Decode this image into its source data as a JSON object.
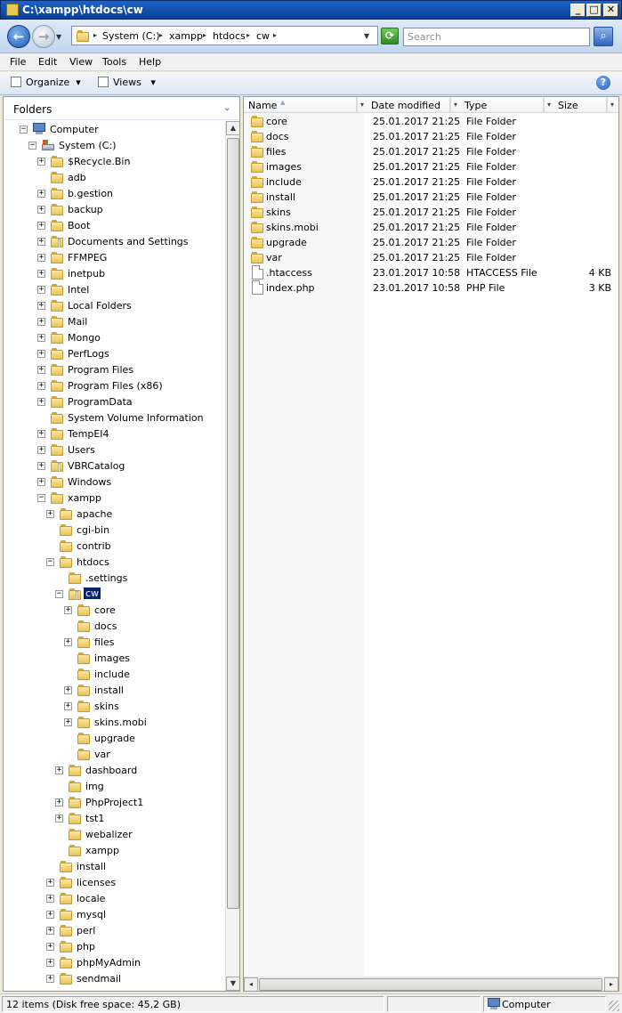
{
  "window": {
    "title": "C:\\xampp\\htdocs\\cw",
    "buttons": {
      "minimize": "_",
      "maximize": "□",
      "close": "✕"
    }
  },
  "address": {
    "crumbs": [
      "System (C:)",
      "xampp",
      "htdocs",
      "cw"
    ],
    "search_placeholder": "Search"
  },
  "menu": [
    "File",
    "Edit",
    "View",
    "Tools",
    "Help"
  ],
  "toolbar": {
    "organize": "Organize",
    "views": "Views",
    "help": "?"
  },
  "folders_pane": {
    "title": "Folders"
  },
  "tree": [
    {
      "label": "Computer",
      "level": 0,
      "icon": "computer-icon",
      "expander": "minus"
    },
    {
      "label": "System (C:)",
      "level": 1,
      "icon": "drive-icon",
      "expander": "minus"
    },
    {
      "label": "$Recycle.Bin",
      "level": 2,
      "icon": "folder-icon",
      "expander": "plus"
    },
    {
      "label": "adb",
      "level": 2,
      "icon": "folder-icon",
      "expander": "none"
    },
    {
      "label": "b.gestion",
      "level": 2,
      "icon": "folder-icon",
      "expander": "plus"
    },
    {
      "label": "backup",
      "level": 2,
      "icon": "folder-icon",
      "expander": "plus"
    },
    {
      "label": "Boot",
      "level": 2,
      "icon": "folder-icon",
      "expander": "plus"
    },
    {
      "label": "Documents and Settings",
      "level": 2,
      "icon": "folder-shortcut-icon",
      "expander": "plus"
    },
    {
      "label": "FFMPEG",
      "level": 2,
      "icon": "folder-icon",
      "expander": "plus"
    },
    {
      "label": "inetpub",
      "level": 2,
      "icon": "folder-icon",
      "expander": "plus"
    },
    {
      "label": "Intel",
      "level": 2,
      "icon": "folder-icon",
      "expander": "plus"
    },
    {
      "label": "Local Folders",
      "level": 2,
      "icon": "folder-icon",
      "expander": "plus"
    },
    {
      "label": "Mail",
      "level": 2,
      "icon": "folder-icon",
      "expander": "plus"
    },
    {
      "label": "Mongo",
      "level": 2,
      "icon": "folder-icon",
      "expander": "plus"
    },
    {
      "label": "PerfLogs",
      "level": 2,
      "icon": "folder-icon",
      "expander": "plus"
    },
    {
      "label": "Program Files",
      "level": 2,
      "icon": "folder-icon",
      "expander": "plus"
    },
    {
      "label": "Program Files (x86)",
      "level": 2,
      "icon": "folder-icon",
      "expander": "plus"
    },
    {
      "label": "ProgramData",
      "level": 2,
      "icon": "folder-icon",
      "expander": "plus"
    },
    {
      "label": "System Volume Information",
      "level": 2,
      "icon": "folder-icon",
      "expander": "none"
    },
    {
      "label": "TempEI4",
      "level": 2,
      "icon": "folder-icon",
      "expander": "plus"
    },
    {
      "label": "Users",
      "level": 2,
      "icon": "folder-icon",
      "expander": "plus"
    },
    {
      "label": "VBRCatalog",
      "level": 2,
      "icon": "folder-special-icon",
      "expander": "plus"
    },
    {
      "label": "Windows",
      "level": 2,
      "icon": "folder-icon",
      "expander": "plus"
    },
    {
      "label": "xampp",
      "level": 2,
      "icon": "folder-icon",
      "expander": "minus"
    },
    {
      "label": "apache",
      "level": 3,
      "icon": "folder-icon",
      "expander": "plus"
    },
    {
      "label": "cgi-bin",
      "level": 3,
      "icon": "folder-icon",
      "expander": "none"
    },
    {
      "label": "contrib",
      "level": 3,
      "icon": "folder-icon",
      "expander": "none"
    },
    {
      "label": "htdocs",
      "level": 3,
      "icon": "folder-icon",
      "expander": "minus"
    },
    {
      "label": ".settings",
      "level": 4,
      "icon": "folder-icon",
      "expander": "none"
    },
    {
      "label": "cw",
      "level": 4,
      "icon": "folder-open-icon",
      "expander": "minus",
      "selected": true
    },
    {
      "label": "core",
      "level": 5,
      "icon": "folder-icon",
      "expander": "plus"
    },
    {
      "label": "docs",
      "level": 5,
      "icon": "folder-icon",
      "expander": "none"
    },
    {
      "label": "files",
      "level": 5,
      "icon": "folder-icon",
      "expander": "plus"
    },
    {
      "label": "images",
      "level": 5,
      "icon": "folder-icon",
      "expander": "none"
    },
    {
      "label": "include",
      "level": 5,
      "icon": "folder-icon",
      "expander": "none"
    },
    {
      "label": "install",
      "level": 5,
      "icon": "folder-icon",
      "expander": "plus"
    },
    {
      "label": "skins",
      "level": 5,
      "icon": "folder-icon",
      "expander": "plus"
    },
    {
      "label": "skins.mobi",
      "level": 5,
      "icon": "folder-icon",
      "expander": "plus"
    },
    {
      "label": "upgrade",
      "level": 5,
      "icon": "folder-icon",
      "expander": "none"
    },
    {
      "label": "var",
      "level": 5,
      "icon": "folder-icon",
      "expander": "none"
    },
    {
      "label": "dashboard",
      "level": 4,
      "icon": "folder-icon",
      "expander": "plus"
    },
    {
      "label": "img",
      "level": 4,
      "icon": "folder-icon",
      "expander": "none"
    },
    {
      "label": "PhpProject1",
      "level": 4,
      "icon": "folder-icon",
      "expander": "plus"
    },
    {
      "label": "tst1",
      "level": 4,
      "icon": "folder-icon",
      "expander": "plus"
    },
    {
      "label": "webalizer",
      "level": 4,
      "icon": "folder-icon",
      "expander": "none"
    },
    {
      "label": "xampp",
      "level": 4,
      "icon": "folder-icon",
      "expander": "none"
    },
    {
      "label": "install",
      "level": 3,
      "icon": "folder-icon",
      "expander": "none"
    },
    {
      "label": "licenses",
      "level": 3,
      "icon": "folder-icon",
      "expander": "plus"
    },
    {
      "label": "locale",
      "level": 3,
      "icon": "folder-icon",
      "expander": "plus"
    },
    {
      "label": "mysql",
      "level": 3,
      "icon": "folder-icon",
      "expander": "plus"
    },
    {
      "label": "perl",
      "level": 3,
      "icon": "folder-icon",
      "expander": "plus"
    },
    {
      "label": "php",
      "level": 3,
      "icon": "folder-icon",
      "expander": "plus"
    },
    {
      "label": "phpMyAdmin",
      "level": 3,
      "icon": "folder-icon",
      "expander": "plus"
    },
    {
      "label": "sendmail",
      "level": 3,
      "icon": "folder-icon",
      "expander": "plus"
    }
  ],
  "columns": {
    "name": "Name",
    "date": "Date modified",
    "type": "Type",
    "size": "Size"
  },
  "files": [
    {
      "name": "core",
      "date": "25.01.2017 21:25",
      "type": "File Folder",
      "size": "",
      "icon": "folder-icon"
    },
    {
      "name": "docs",
      "date": "25.01.2017 21:25",
      "type": "File Folder",
      "size": "",
      "icon": "folder-icon"
    },
    {
      "name": "files",
      "date": "25.01.2017 21:25",
      "type": "File Folder",
      "size": "",
      "icon": "folder-icon"
    },
    {
      "name": "images",
      "date": "25.01.2017 21:25",
      "type": "File Folder",
      "size": "",
      "icon": "folder-icon"
    },
    {
      "name": "include",
      "date": "25.01.2017 21:25",
      "type": "File Folder",
      "size": "",
      "icon": "folder-icon"
    },
    {
      "name": "install",
      "date": "25.01.2017 21:25",
      "type": "File Folder",
      "size": "",
      "icon": "folder-icon"
    },
    {
      "name": "skins",
      "date": "25.01.2017 21:25",
      "type": "File Folder",
      "size": "",
      "icon": "folder-icon"
    },
    {
      "name": "skins.mobi",
      "date": "25.01.2017 21:25",
      "type": "File Folder",
      "size": "",
      "icon": "folder-icon"
    },
    {
      "name": "upgrade",
      "date": "25.01.2017 21:25",
      "type": "File Folder",
      "size": "",
      "icon": "folder-icon"
    },
    {
      "name": "var",
      "date": "25.01.2017 21:25",
      "type": "File Folder",
      "size": "",
      "icon": "folder-icon"
    },
    {
      "name": ".htaccess",
      "date": "23.01.2017 10:58",
      "type": "HTACCESS File",
      "size": "4 KB",
      "icon": "file-icon"
    },
    {
      "name": "index.php",
      "date": "23.01.2017 10:58",
      "type": "PHP File",
      "size": "3 KB",
      "icon": "file-icon"
    }
  ],
  "status": {
    "items": "12 items (Disk free space: 45,2 GB)",
    "location": "Computer"
  }
}
